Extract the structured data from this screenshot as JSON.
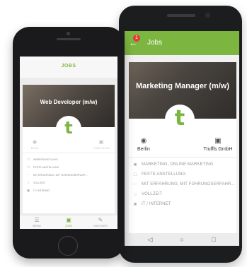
{
  "android": {
    "appbar": {
      "title": "Jobs",
      "back_icon": "back-arrow-icon",
      "badge_count": "1"
    },
    "job": {
      "title": "Marketing Manager (m/w)",
      "logo_letter": "t",
      "location": "Berlin",
      "company": "Truffls GmbH",
      "details": [
        {
          "icon": "briefcase-icon",
          "text": "MARKETING, ONLINE MARKETING"
        },
        {
          "icon": "document-icon",
          "text": "FESTE ANSTELLUNG"
        },
        {
          "icon": "experience-icon",
          "text": "MIT ERFAHRUNG, MIT FÜHRUNGSERFAHR..."
        },
        {
          "icon": "clock-icon",
          "text": "VOLLZEIT"
        },
        {
          "icon": "industry-icon",
          "text": "IT / INTERNET"
        }
      ]
    },
    "navbar": [
      "back-triangle-icon",
      "home-circle-icon",
      "recent-square-icon"
    ]
  },
  "iphone": {
    "header_title": "JOBS",
    "job": {
      "title": "Web Developer (m/w)",
      "logo_letter": "t",
      "location": "Berlin",
      "company": "Truffls GmbH",
      "details": [
        {
          "icon": "briefcase-icon",
          "text": "WEBENTWICKLUNG"
        },
        {
          "icon": "document-icon",
          "text": "FESTE ANSTELLUNG"
        },
        {
          "icon": "experience-icon",
          "text": "MIT ERFAHRUNG, MIT FÜHRUNGSERFAHR..."
        },
        {
          "icon": "clock-icon",
          "text": "VOLLZEIT"
        },
        {
          "icon": "industry-icon",
          "text": "IT / INTERNET"
        }
      ]
    },
    "tabs": [
      {
        "label": "MENÜ",
        "icon": "menu-icon",
        "active": false
      },
      {
        "label": "JOBS",
        "icon": "jobs-icon",
        "active": true
      },
      {
        "label": "MATCHES",
        "icon": "matches-icon",
        "active": false
      }
    ]
  },
  "colors": {
    "accent_green": "#7cb640",
    "badge_red": "#e53935"
  }
}
